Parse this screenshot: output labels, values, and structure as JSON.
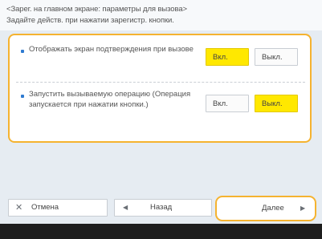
{
  "header": {
    "title": "<Зарег. на главном экране: параметры для вызова>",
    "instruction": "Задайте действ. при нажатии зарегистр. кнопки."
  },
  "options": [
    {
      "label": "Отображать экран подтверждения при вызове",
      "on_label": "Вкл.",
      "off_label": "Выкл.",
      "selected": "on"
    },
    {
      "label": "Запустить вызываемую операцию (Операция запускается при нажатии кнопки.)",
      "on_label": "Вкл.",
      "off_label": "Выкл.",
      "selected": "off"
    }
  ],
  "footer": {
    "cancel_label": "Отмена",
    "back_label": "Назад",
    "next_label": "Далее"
  },
  "icons": {
    "cancel": "close-icon",
    "back": "left-arrow-icon",
    "next": "right-arrow-icon"
  },
  "colors": {
    "highlight_border": "#f5b330",
    "selected_button": "#ffe800",
    "bullet": "#2f7bd1",
    "background": "#e6ecf2",
    "bottom_bar": "#1e1e1e"
  }
}
